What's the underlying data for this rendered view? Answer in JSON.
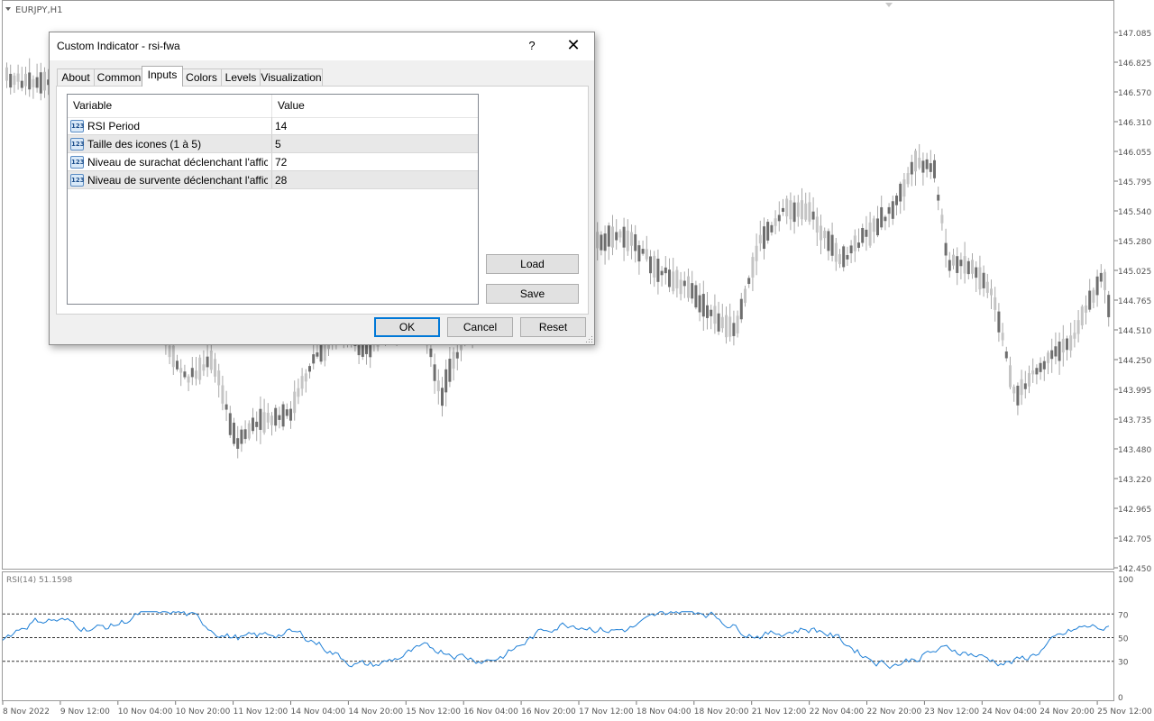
{
  "chart": {
    "symbol_label": "EURJPY,H1",
    "price_ticks": [
      "147.085",
      "146.825",
      "146.570",
      "146.310",
      "146.055",
      "145.795",
      "145.540",
      "145.280",
      "145.025",
      "144.765",
      "144.510",
      "144.250",
      "143.995",
      "143.735",
      "143.480",
      "143.220",
      "142.965",
      "142.705",
      "142.450"
    ],
    "time_ticks": [
      "8 Nov 2022",
      "9 Nov 12:00",
      "10 Nov 04:00",
      "10 Nov 20:00",
      "11 Nov 12:00",
      "14 Nov 04:00",
      "14 Nov 20:00",
      "15 Nov 12:00",
      "16 Nov 04:00",
      "16 Nov 20:00",
      "17 Nov 12:00",
      "18 Nov 04:00",
      "18 Nov 20:00",
      "21 Nov 12:00",
      "22 Nov 04:00",
      "22 Nov 20:00",
      "23 Nov 12:00",
      "24 Nov 04:00",
      "24 Nov 20:00",
      "25 Nov 12:00"
    ]
  },
  "rsi_panel": {
    "label": "RSI(14) 51.1598",
    "scale_ticks": [
      "100",
      "70",
      "50",
      "30",
      "0"
    ],
    "levels": [
      70,
      50,
      30
    ],
    "line_color": "#1e7fd6"
  },
  "dialog": {
    "title": "Custom Indicator - rsi-fwa",
    "help_label": "?",
    "close_label": "✕",
    "tabs": [
      "About",
      "Common",
      "Inputs",
      "Colors",
      "Levels",
      "Visualization"
    ],
    "active_tab": "Inputs",
    "grid": {
      "col_variable": "Variable",
      "col_value": "Value",
      "rows": [
        {
          "icon": "123",
          "name": "RSI Period",
          "value": "14"
        },
        {
          "icon": "123",
          "name": "Taille des icones (1 à 5)",
          "value": "5"
        },
        {
          "icon": "123",
          "name": "Niveau de surachat déclenchant l'affich...",
          "value": "72"
        },
        {
          "icon": "123",
          "name": "Niveau de survente déclenchant l'affich...",
          "value": "28"
        }
      ]
    },
    "load_label": "Load",
    "save_label": "Save",
    "ok_label": "OK",
    "cancel_label": "Cancel",
    "reset_label": "Reset"
  }
}
